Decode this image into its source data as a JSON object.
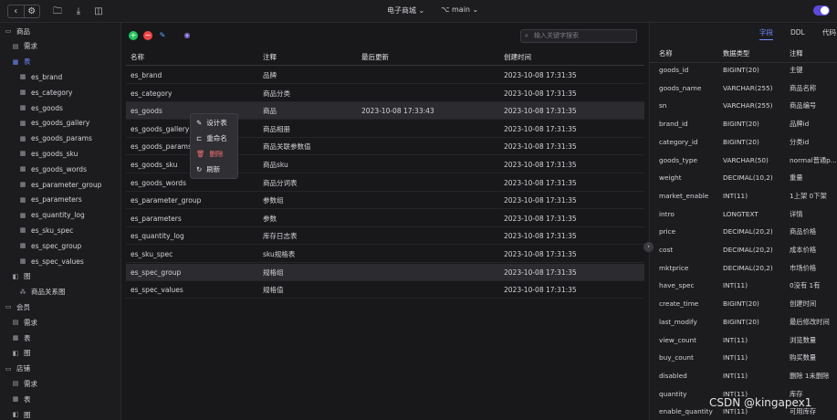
{
  "topbar": {
    "back_icon": "‹",
    "settings_icon": "⚙",
    "toolbar_icons": [
      "🗀",
      "⤓",
      "◫"
    ],
    "db_name": "电子商城 ⌄",
    "branch": "⌥ main ⌄"
  },
  "sidebar": {
    "items": [
      {
        "label": "商品",
        "icon": "▭",
        "indent": 0
      },
      {
        "label": "需求",
        "icon": "▤",
        "indent": 1
      },
      {
        "label": "表",
        "icon": "▦",
        "indent": 1,
        "active": true
      },
      {
        "label": "es_brand",
        "icon": "▦",
        "indent": 2
      },
      {
        "label": "es_category",
        "icon": "▦",
        "indent": 2
      },
      {
        "label": "es_goods",
        "icon": "▦",
        "indent": 2
      },
      {
        "label": "es_goods_gallery",
        "icon": "▦",
        "indent": 2
      },
      {
        "label": "es_goods_params",
        "icon": "▦",
        "indent": 2
      },
      {
        "label": "es_goods_sku",
        "icon": "▦",
        "indent": 2
      },
      {
        "label": "es_goods_words",
        "icon": "▦",
        "indent": 2
      },
      {
        "label": "es_parameter_group",
        "icon": "▦",
        "indent": 2
      },
      {
        "label": "es_parameters",
        "icon": "▦",
        "indent": 2
      },
      {
        "label": "es_quantity_log",
        "icon": "▦",
        "indent": 2
      },
      {
        "label": "es_sku_spec",
        "icon": "▦",
        "indent": 2
      },
      {
        "label": "es_spec_group",
        "icon": "▦",
        "indent": 2
      },
      {
        "label": "es_spec_values",
        "icon": "▦",
        "indent": 2
      },
      {
        "label": "图",
        "icon": "◧",
        "indent": 1
      },
      {
        "label": "商品关系图",
        "icon": "⁂",
        "indent": 2
      },
      {
        "label": "会员",
        "icon": "▭",
        "indent": 0
      },
      {
        "label": "需求",
        "icon": "▤",
        "indent": 1
      },
      {
        "label": "表",
        "icon": "▦",
        "indent": 1
      },
      {
        "label": "图",
        "icon": "◧",
        "indent": 1
      },
      {
        "label": "店铺",
        "icon": "▭",
        "indent": 0
      },
      {
        "label": "需求",
        "icon": "▤",
        "indent": 1
      },
      {
        "label": "表",
        "icon": "▦",
        "indent": 1
      },
      {
        "label": "图",
        "icon": "◧",
        "indent": 1
      }
    ]
  },
  "main": {
    "search_placeholder": "输入关键字搜索",
    "columns": [
      "名称",
      "注释",
      "最后更新",
      "创建时间"
    ],
    "rows": [
      [
        "es_brand",
        "品牌",
        "",
        "2023-10-08 17:31:35"
      ],
      [
        "es_category",
        "商品分类",
        "",
        "2023-10-08 17:31:35"
      ],
      [
        "es_goods",
        "商品",
        "2023-10-08 17:33:43",
        "2023-10-08 17:31:35"
      ],
      [
        "es_goods_gallery",
        "商品相册",
        "",
        "2023-10-08 17:31:35"
      ],
      [
        "es_goods_params",
        "商品关联参数值",
        "",
        "2023-10-08 17:31:35"
      ],
      [
        "es_goods_sku",
        "商品sku",
        "",
        "2023-10-08 17:31:35"
      ],
      [
        "es_goods_words",
        "商品分词表",
        "",
        "2023-10-08 17:31:35"
      ],
      [
        "es_parameter_group",
        "参数组",
        "",
        "2023-10-08 17:31:35"
      ],
      [
        "es_parameters",
        "参数",
        "",
        "2023-10-08 17:31:35"
      ],
      [
        "es_quantity_log",
        "库存日志表",
        "",
        "2023-10-08 17:31:35"
      ],
      [
        "es_sku_spec",
        "sku规格表",
        "",
        "2023-10-08 17:31:35"
      ],
      [
        "es_spec_group",
        "规格组",
        "",
        "2023-10-08 17:31:35"
      ],
      [
        "es_spec_values",
        "规格值",
        "",
        "2023-10-08 17:31:35"
      ]
    ],
    "selected_rows": [
      2,
      11
    ]
  },
  "context_menu": {
    "items": [
      {
        "label": "设计表",
        "icon": "✎",
        "danger": false
      },
      {
        "label": "重命名",
        "icon": "⊏",
        "danger": false
      },
      {
        "label": "删除",
        "icon": "🗑",
        "danger": true
      },
      {
        "label": "刷新",
        "icon": "↻",
        "danger": false
      }
    ]
  },
  "right_panel": {
    "tabs": [
      "字段",
      "DDL",
      "代码"
    ],
    "active_tab": "字段",
    "columns": [
      "名称",
      "数据类型",
      "注释"
    ],
    "fields": [
      [
        "goods_id",
        "BIGINT(20)",
        "主键"
      ],
      [
        "goods_name",
        "VARCHAR(255)",
        "商品名称"
      ],
      [
        "sn",
        "VARCHAR(255)",
        "商品编号"
      ],
      [
        "brand_id",
        "BIGINT(20)",
        "品牌id"
      ],
      [
        "category_id",
        "BIGINT(20)",
        "分类id"
      ],
      [
        "goods_type",
        "VARCHAR(50)",
        "normal普通p..."
      ],
      [
        "weight",
        "DECIMAL(10,2)",
        "重量"
      ],
      [
        "market_enable",
        "INT(11)",
        "1上架 0下架"
      ],
      [
        "intro",
        "LONGTEXT",
        "详情"
      ],
      [
        "price",
        "DECIMAL(20,2)",
        "商品价格"
      ],
      [
        "cost",
        "DECIMAL(20,2)",
        "成本价格"
      ],
      [
        "mktprice",
        "DECIMAL(20,2)",
        "市场价格"
      ],
      [
        "have_spec",
        "INT(11)",
        "0没有 1有"
      ],
      [
        "create_time",
        "BIGINT(20)",
        "创建时间"
      ],
      [
        "last_modify",
        "BIGINT(20)",
        "最后修改时间"
      ],
      [
        "view_count",
        "INT(11)",
        "浏览数量"
      ],
      [
        "buy_count",
        "INT(11)",
        "购买数量"
      ],
      [
        "disabled",
        "INT(11)",
        "删除 1未删除"
      ],
      [
        "quantity",
        "INT(11)",
        "库存"
      ],
      [
        "enable_quantity",
        "INT(11)",
        "可用库存"
      ]
    ]
  },
  "watermark": "CSDN @kingapex1",
  "colors": {
    "accent": "#6f8cff",
    "add": "#22c55e",
    "remove": "#ef4444",
    "edit": "#3b82f6",
    "toggle": "#5b4bd6"
  }
}
